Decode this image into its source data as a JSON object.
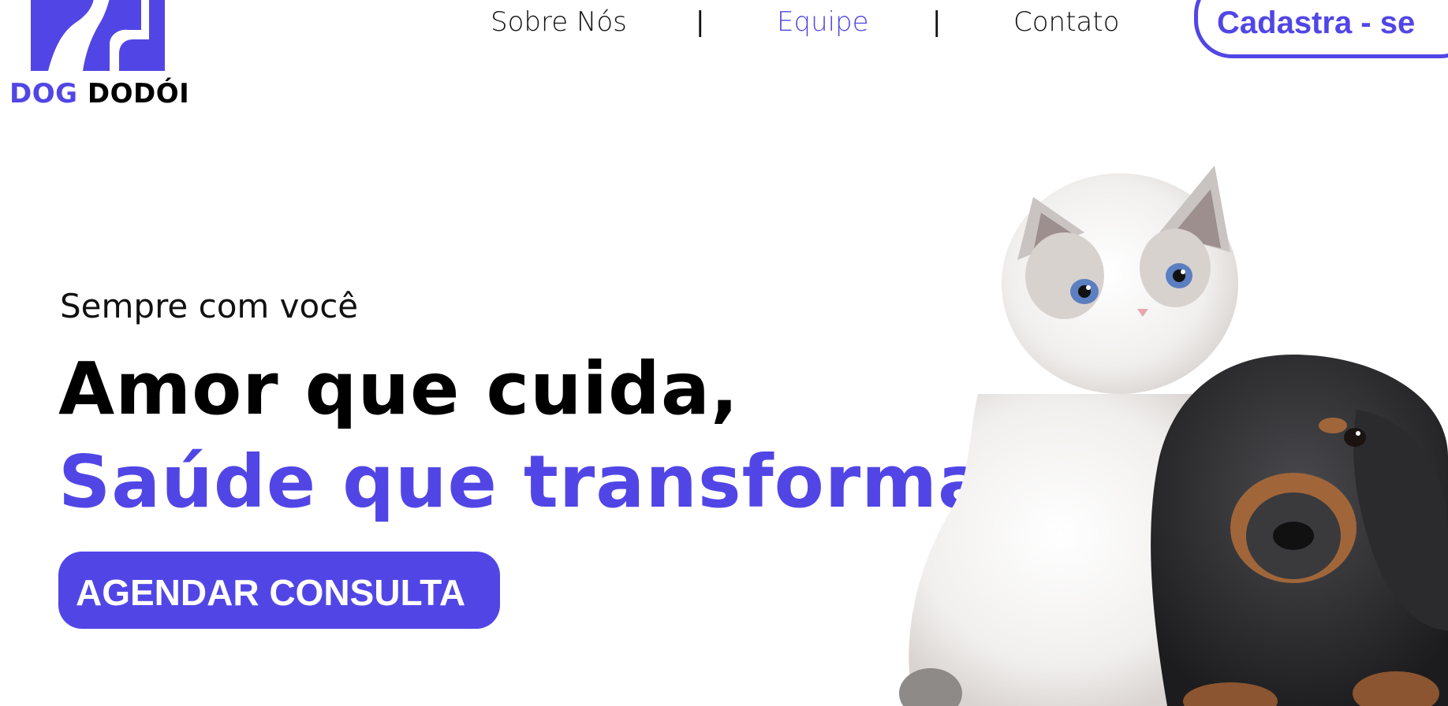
{
  "brand": {
    "name_part1": "DOG",
    "name_part2": "DODÓI",
    "accent_color": "#5146e5",
    "logo_icon": "dog-cat-silhouette-icon"
  },
  "nav": {
    "items": [
      {
        "label": "Sobre Nós",
        "active": false
      },
      {
        "label": "Equipe",
        "active": true
      },
      {
        "label": "Contato",
        "active": false
      }
    ],
    "separator": "|",
    "signup_label": "Cadastra - se"
  },
  "hero": {
    "eyebrow": "Sempre com você",
    "headline_line1": "Amor que cuida,",
    "headline_line2": "Saúde que transforma.",
    "cta_label": "AGENDAR CONSULTA",
    "image": "kitten-and-puppy-photo"
  }
}
